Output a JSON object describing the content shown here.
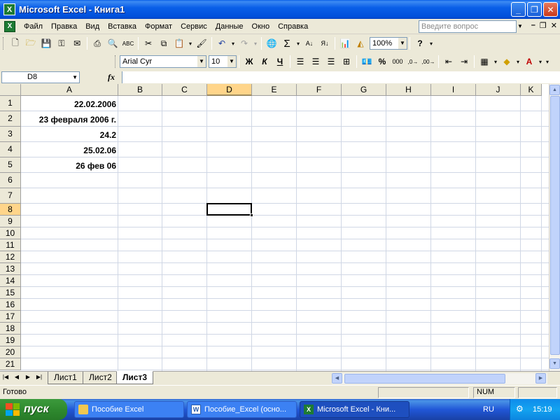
{
  "window": {
    "app_icon_letter": "X",
    "title": "Microsoft Excel - Книга1",
    "minimize_icon": "minimize-icon",
    "restore_icon": "restore-icon",
    "close_icon": "close-icon"
  },
  "menubar": {
    "items": [
      "Файл",
      "Правка",
      "Вид",
      "Вставка",
      "Формат",
      "Сервис",
      "Данные",
      "Окно",
      "Справка"
    ],
    "help_placeholder": "Введите вопрос"
  },
  "toolbar_standard": {
    "zoom": "100%"
  },
  "toolbar_format": {
    "font": "Arial Cyr",
    "size": "10",
    "bold": "Ж",
    "italic": "К",
    "underline": "Ч",
    "percent": "%",
    "thousands": "000"
  },
  "formula_bar": {
    "name_box": "D8",
    "fx_label": "fx",
    "content": ""
  },
  "sheet": {
    "columns": [
      "A",
      "B",
      "C",
      "D",
      "E",
      "F",
      "G",
      "H",
      "I",
      "J",
      "K"
    ],
    "selected_column": "D",
    "rows": [
      "1",
      "2",
      "3",
      "4",
      "5",
      "6",
      "7",
      "8",
      "9",
      "10",
      "11",
      "12",
      "13",
      "14",
      "15",
      "16",
      "17",
      "18",
      "19",
      "20",
      "21"
    ],
    "selected_row": "8",
    "active_cell": "D8",
    "cells": {
      "A1": "22.02.2006",
      "A2": "23 февраля 2006 г.",
      "A3": "24.2",
      "A4": "25.02.06",
      "A5": "26 фев 06"
    }
  },
  "tabs": {
    "items": [
      "Лист1",
      "Лист2",
      "Лист3"
    ],
    "active": "Лист3"
  },
  "statusbar": {
    "ready": "Готово",
    "num": "NUM"
  },
  "taskbar": {
    "start": "пуск",
    "items": [
      "Пособие Excel",
      "Пособие_Excel (осно...",
      "Microsoft Excel - Кни..."
    ],
    "active_index": 2,
    "lang": "RU",
    "clock": "15:19"
  },
  "colors": {
    "titlebar": "#0A5FE8",
    "selected_header": "#FFD58A",
    "excel_green": "#1E7B34"
  }
}
